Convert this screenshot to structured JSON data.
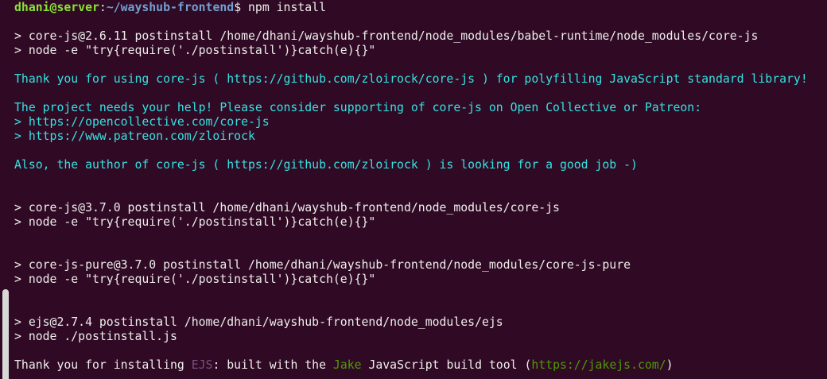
{
  "terminal": {
    "colors": {
      "background": "#300a24",
      "text": "#eeeeec",
      "user": "#8ae234",
      "path": "#729fcf",
      "message": "#34e2e2",
      "accent": "#4e9a06"
    },
    "lines": [
      {
        "type": "prompt",
        "segments": [
          {
            "text": "dhani@server",
            "cls": "prompt-user"
          },
          {
            "text": ":",
            "cls": "c-default"
          },
          {
            "text": "~/wayshub-frontend",
            "cls": "prompt-path"
          },
          {
            "text": "$ npm install",
            "cls": "c-default"
          }
        ]
      },
      {
        "type": "blank",
        "segments": []
      },
      {
        "type": "output",
        "segments": [
          {
            "text": "> core-js@2.6.11 postinstall /home/dhani/wayshub-frontend/node_modules/babel-runtime/node_modules/core-js",
            "cls": "c-default"
          }
        ]
      },
      {
        "type": "output",
        "segments": [
          {
            "text": "> node -e \"try{require('./postinstall')}catch(e){}\"",
            "cls": "c-default"
          }
        ]
      },
      {
        "type": "blank",
        "segments": []
      },
      {
        "type": "output",
        "segments": [
          {
            "text": "Thank you for using core-js ( https://github.com/zloirock/core-js ) for polyfilling JavaScript standard library!",
            "cls": "c-cyan"
          }
        ]
      },
      {
        "type": "blank",
        "segments": []
      },
      {
        "type": "output",
        "segments": [
          {
            "text": "The project needs your help! Please consider supporting of core-js on Open Collective or Patreon:",
            "cls": "c-cyan"
          }
        ]
      },
      {
        "type": "output",
        "segments": [
          {
            "text": "> https://opencollective.com/core-js",
            "cls": "c-cyan"
          }
        ]
      },
      {
        "type": "output",
        "segments": [
          {
            "text": "> https://www.patreon.com/zloirock",
            "cls": "c-cyan"
          }
        ]
      },
      {
        "type": "blank",
        "segments": []
      },
      {
        "type": "output",
        "segments": [
          {
            "text": "Also, the author of core-js ( https://github.com/zloirock ) is looking for a good job -)",
            "cls": "c-cyan"
          }
        ]
      },
      {
        "type": "blank",
        "segments": []
      },
      {
        "type": "blank",
        "segments": []
      },
      {
        "type": "output",
        "segments": [
          {
            "text": "> core-js@3.7.0 postinstall /home/dhani/wayshub-frontend/node_modules/core-js",
            "cls": "c-default"
          }
        ]
      },
      {
        "type": "output",
        "segments": [
          {
            "text": "> node -e \"try{require('./postinstall')}catch(e){}\"",
            "cls": "c-default"
          }
        ]
      },
      {
        "type": "blank",
        "segments": []
      },
      {
        "type": "blank",
        "segments": []
      },
      {
        "type": "output",
        "segments": [
          {
            "text": "> core-js-pure@3.7.0 postinstall /home/dhani/wayshub-frontend/node_modules/core-js-pure",
            "cls": "c-default"
          }
        ]
      },
      {
        "type": "output",
        "segments": [
          {
            "text": "> node -e \"try{require('./postinstall')}catch(e){}\"",
            "cls": "c-default"
          }
        ]
      },
      {
        "type": "blank",
        "segments": []
      },
      {
        "type": "blank",
        "segments": []
      },
      {
        "type": "output",
        "segments": [
          {
            "text": "> ejs@2.7.4 postinstall /home/dhani/wayshub-frontend/node_modules/ejs",
            "cls": "c-default"
          }
        ]
      },
      {
        "type": "output",
        "segments": [
          {
            "text": "> node ./postinstall.js",
            "cls": "c-default"
          }
        ]
      },
      {
        "type": "blank",
        "segments": []
      },
      {
        "type": "output",
        "segments": [
          {
            "text": "Thank you for installing ",
            "cls": "c-default"
          },
          {
            "text": "EJS",
            "cls": "c-dim"
          },
          {
            "text": ": built with the ",
            "cls": "c-default"
          },
          {
            "text": "Jake",
            "cls": "c-green"
          },
          {
            "text": " JavaScript build tool (",
            "cls": "c-default"
          },
          {
            "text": "https://jakejs.com/",
            "cls": "c-green"
          },
          {
            "text": ")",
            "cls": "c-default"
          }
        ]
      }
    ]
  }
}
